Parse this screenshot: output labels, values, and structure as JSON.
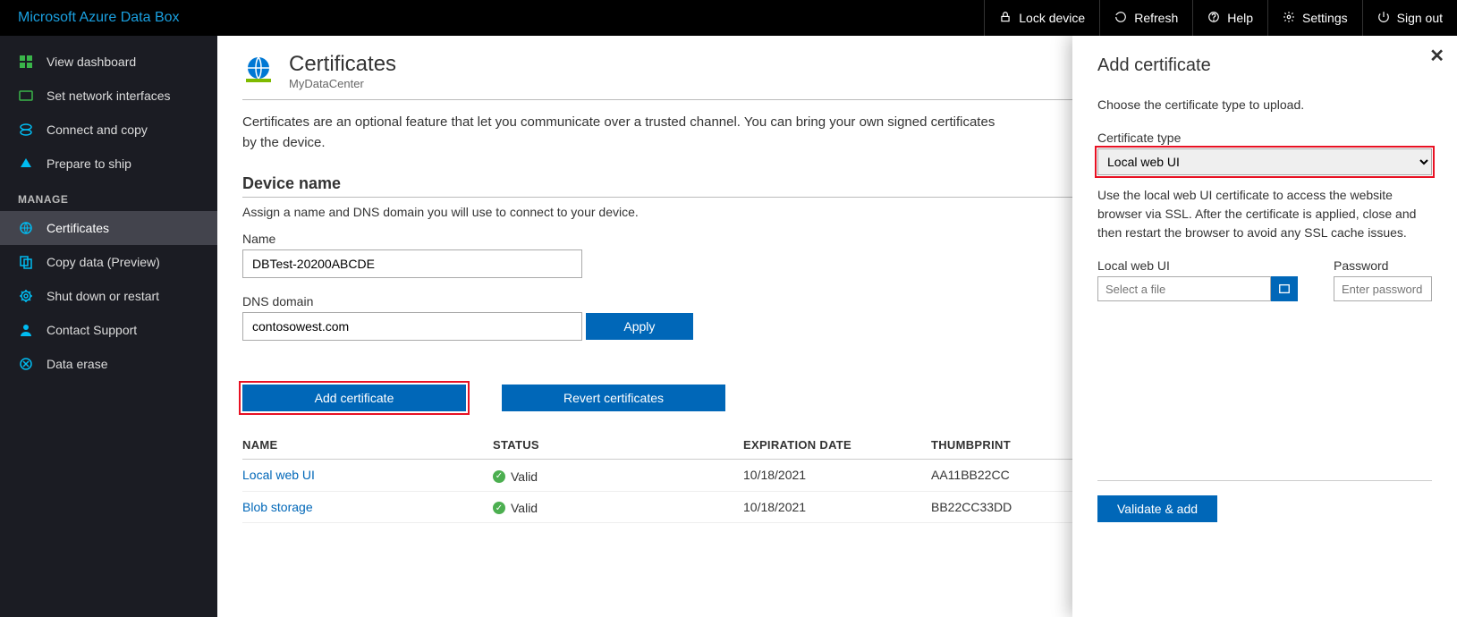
{
  "topbar": {
    "brand": "Microsoft Azure Data Box",
    "actions": {
      "lock": "Lock device",
      "refresh": "Refresh",
      "help": "Help",
      "settings": "Settings",
      "signout": "Sign out"
    }
  },
  "sidebar": {
    "items": [
      {
        "icon": "dashboard",
        "label": "View dashboard"
      },
      {
        "icon": "network",
        "label": "Set network interfaces"
      },
      {
        "icon": "connect",
        "label": "Connect and copy"
      },
      {
        "icon": "ship",
        "label": "Prepare to ship"
      }
    ],
    "section_label": "MANAGE",
    "manage_items": [
      {
        "icon": "cert",
        "label": "Certificates",
        "active": true
      },
      {
        "icon": "copy",
        "label": "Copy data (Preview)"
      },
      {
        "icon": "power",
        "label": "Shut down or restart"
      },
      {
        "icon": "support",
        "label": "Contact Support"
      },
      {
        "icon": "erase",
        "label": "Data erase"
      }
    ]
  },
  "main": {
    "title": "Certificates",
    "subtitle": "MyDataCenter",
    "intro": "Certificates are an optional feature that let you communicate over a trusted channel. You can bring your own signed certificates by the device.",
    "device_section_title": "Device name",
    "device_section_desc": "Assign a name and DNS domain you will use to connect to your device.",
    "name_label": "Name",
    "name_value": "DBTest-20200ABCDE",
    "dns_label": "DNS domain",
    "dns_value": "contosowest.com",
    "apply_label": "Apply",
    "add_cert_label": "Add certificate",
    "revert_label": "Revert certificates",
    "table": {
      "headers": {
        "name": "NAME",
        "status": "STATUS",
        "expiration": "EXPIRATION DATE",
        "thumbprint": "THUMBPRINT"
      },
      "rows": [
        {
          "name": "Local web UI",
          "status": "Valid",
          "expiration": "10/18/2021",
          "thumbprint": "AA11BB22CC"
        },
        {
          "name": "Blob storage",
          "status": "Valid",
          "expiration": "10/18/2021",
          "thumbprint": "BB22CC33DD"
        }
      ]
    }
  },
  "panel": {
    "title": "Add certificate",
    "intro": "Choose the certificate type to upload.",
    "type_label": "Certificate type",
    "type_value": "Local web UI",
    "type_help": "Use the local web UI certificate to access the website browser via SSL. After the certificate is applied, close and then restart the browser to avoid any SSL cache issues.",
    "file_label": "Local web UI",
    "file_placeholder": "Select a file",
    "password_label": "Password",
    "password_placeholder": "Enter password",
    "validate_label": "Validate & add"
  }
}
